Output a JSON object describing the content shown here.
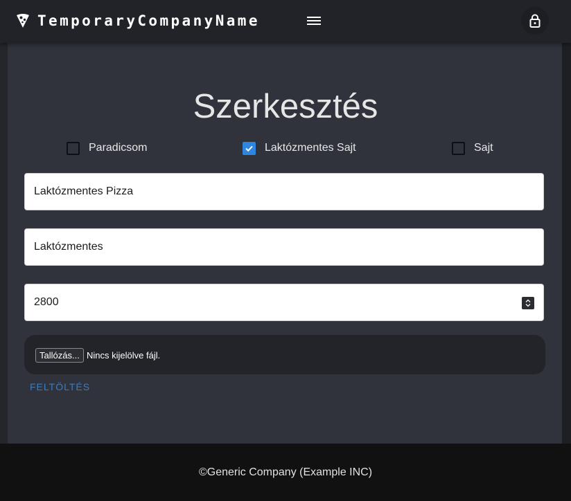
{
  "header": {
    "brand_name": "TemporaryCompanyName",
    "brand_icon": "pizza-slice-icon",
    "menu_icon": "hamburger-menu-icon",
    "lock_icon": "lock-icon"
  },
  "page": {
    "title": "Szerkesztés"
  },
  "toppings": [
    {
      "label": "Paradicsom",
      "checked": false
    },
    {
      "label": "Laktózmentes Sajt",
      "checked": true
    },
    {
      "label": "Sajt",
      "checked": false
    }
  ],
  "form": {
    "name_value": "Laktózmentes Pizza",
    "description_value": "Laktózmentes",
    "price_value": "2800",
    "file_button_label": "Tallózás...",
    "file_status": "Nincs kijelölve fájl.",
    "upload_label": "FELTÖLTÉS"
  },
  "footer": {
    "copyright": "©Generic Company (Example INC)"
  },
  "colors": {
    "accent": "#2e86de",
    "background": "#24262c",
    "card": "#30333b",
    "footer": "#111111"
  }
}
